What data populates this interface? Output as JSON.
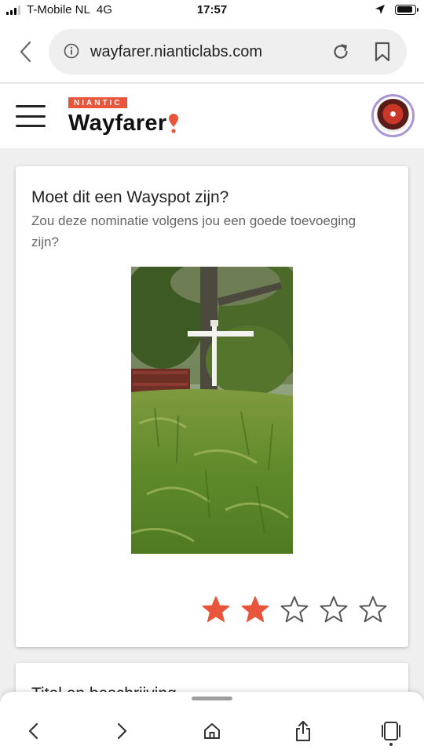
{
  "status_bar": {
    "carrier": "T-Mobile NL",
    "network": "4G",
    "time": "17:57",
    "battery_level": 0.9
  },
  "browser": {
    "url": "wayfarer.nianticlabs.com",
    "icons": [
      "back-icon",
      "info-icon",
      "reload-icon",
      "bookmark-icon"
    ]
  },
  "header": {
    "brand_badge": "NIANTIC",
    "brand_name": "Wayfarer",
    "brand_color": "#e8553b",
    "avatar_ring_color": "#a996d4"
  },
  "card": {
    "title": "Moet dit een Wayspot zijn?",
    "subtitle": "Zou deze nominatie volgens jou een goede toevoeging zijn?",
    "photo_description_icon": "nomination-photo",
    "rating": {
      "value": 2,
      "max": 5,
      "filled_color": "#e8553b",
      "empty_color": "#555555"
    }
  },
  "next_card": {
    "title": "Titel en beschrijving"
  },
  "toolbar": {
    "icons": [
      "back-icon",
      "forward-icon",
      "home-icon",
      "share-icon",
      "tabs-icon"
    ]
  }
}
